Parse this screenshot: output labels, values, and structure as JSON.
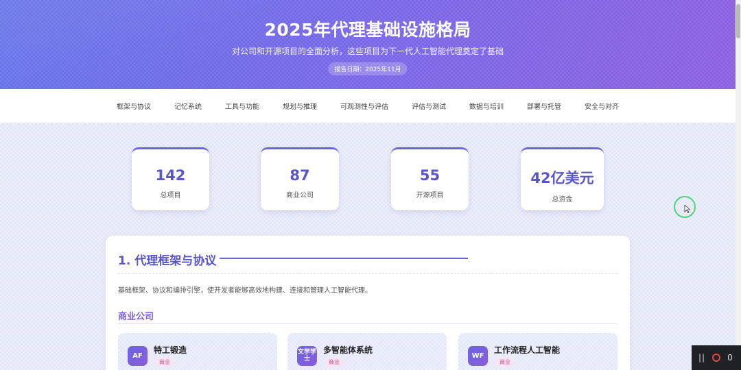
{
  "header": {
    "title": "2025年代理基础设施格局",
    "subtitle": "对公司和开源项目的全面分析，这些项目为下一代人工智能代理奠定了基础",
    "date": "报告日期：2025年11月"
  },
  "nav": {
    "items": [
      "框架与协议",
      "记忆系统",
      "工具与功能",
      "规划与推理",
      "可观测性与评估",
      "评估与测试",
      "数据与培训",
      "部署与托管",
      "安全与对齐"
    ]
  },
  "stats": [
    {
      "value": "142",
      "label": "总项目"
    },
    {
      "value": "87",
      "label": "商业公司"
    },
    {
      "value": "55",
      "label": "开源项目"
    },
    {
      "value": "42亿美元",
      "label": "总资金"
    }
  ],
  "section": {
    "title": "1. 代理框架与协议",
    "description": "基础框架、协议和编排引擎，使开发者能够高效地构建、连接和管理人工智能代理。",
    "subheading": "商业公司",
    "cards": [
      {
        "badge": "AF",
        "name": "特工锻造",
        "tag": "商业"
      },
      {
        "badge": "文学学士",
        "name": "多智能体系统",
        "tag": "商业"
      },
      {
        "badge": "WF",
        "name": "工作流程人工智能",
        "tag": "商业"
      }
    ]
  },
  "recorder": {
    "pause": "||",
    "count": "0"
  }
}
